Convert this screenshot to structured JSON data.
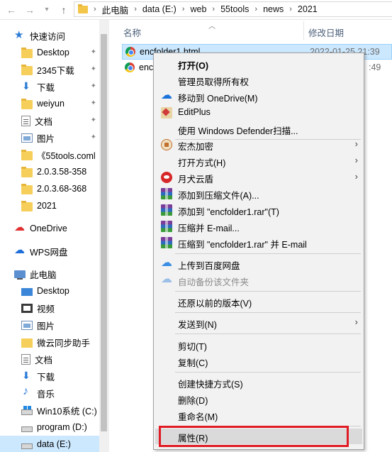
{
  "address_bar": {
    "breadcrumbs": [
      "此电脑",
      "data (E:)",
      "web",
      "55tools",
      "news",
      "2021"
    ]
  },
  "sidebar": {
    "items": [
      {
        "label": "快速访问",
        "icon": "star-icon"
      },
      {
        "label": "Desktop",
        "icon": "folder-icon",
        "pinned": true
      },
      {
        "label": "2345下载",
        "icon": "folder-icon",
        "pinned": true
      },
      {
        "label": "下载",
        "icon": "download-icon",
        "pinned": true
      },
      {
        "label": "weiyun",
        "icon": "folder-icon",
        "pinned": true
      },
      {
        "label": "文档",
        "icon": "document-icon",
        "pinned": true
      },
      {
        "label": "图片",
        "icon": "picture-icon",
        "pinned": true
      },
      {
        "label": "《55tools.coml",
        "icon": "folder-icon"
      },
      {
        "label": "2.0.3.58-358",
        "icon": "folder-icon"
      },
      {
        "label": "2.0.3.68-368",
        "icon": "folder-icon"
      },
      {
        "label": "2021",
        "icon": "folder-icon"
      },
      {
        "label": "OneDrive",
        "icon": "onedrive-icon"
      },
      {
        "label": "WPS网盘",
        "icon": "wps-cloud-icon"
      },
      {
        "label": "此电脑",
        "icon": "computer-icon"
      },
      {
        "label": "Desktop",
        "icon": "desktop-icon"
      },
      {
        "label": "视频",
        "icon": "video-icon"
      },
      {
        "label": "图片",
        "icon": "picture-icon"
      },
      {
        "label": "微云同步助手",
        "icon": "folder-icon"
      },
      {
        "label": "文档",
        "icon": "document-icon"
      },
      {
        "label": "下载",
        "icon": "download-icon"
      },
      {
        "label": "音乐",
        "icon": "music-icon"
      },
      {
        "label": "Win10系统 (C:)",
        "icon": "windows-drive-icon"
      },
      {
        "label": "program (D:)",
        "icon": "drive-icon"
      },
      {
        "label": "data (E:)",
        "icon": "drive-icon"
      }
    ]
  },
  "file_list": {
    "columns": {
      "name": "名称",
      "date": "修改日期"
    },
    "rows": [
      {
        "name": "encfolder1.html",
        "date": "2022-01-25 21:39",
        "selected": true
      },
      {
        "name": "enc",
        "date": ":49",
        "selected": false
      }
    ]
  },
  "context_menu": {
    "items": [
      {
        "label": "打开(O)",
        "bold": true
      },
      {
        "label": "管理员取得所有权"
      },
      {
        "label": "移动到 OneDrive(M)",
        "icon": "onedrive-icon"
      },
      {
        "label": "EditPlus",
        "icon": "editplus-icon"
      },
      {
        "label": "使用 Windows Defender扫描..."
      },
      {
        "label": "宏杰加密",
        "icon": "lock-icon",
        "submenu": true
      },
      {
        "label": "打开方式(H)",
        "submenu": true
      },
      {
        "label": "月犬云盾",
        "icon": "yuedun-icon",
        "submenu": true
      },
      {
        "label": "添加到压缩文件(A)...",
        "icon": "winrar-icon"
      },
      {
        "label": "添加到 \"encfolder1.rar\"(T)",
        "icon": "winrar-icon"
      },
      {
        "label": "压缩并 E-mail...",
        "icon": "winrar-icon"
      },
      {
        "label": "压缩到 \"encfolder1.rar\" 并 E-mail",
        "icon": "winrar-icon"
      },
      {
        "label": "上传到百度网盘",
        "icon": "baidu-cloud-icon"
      },
      {
        "label": "自动备份该文件夹",
        "icon": "baidu-cloud-icon",
        "disabled": true
      },
      {
        "label": "还原以前的版本(V)"
      },
      {
        "label": "发送到(N)",
        "submenu": true
      },
      {
        "label": "剪切(T)"
      },
      {
        "label": "复制(C)"
      },
      {
        "label": "创建快捷方式(S)"
      },
      {
        "label": "删除(D)"
      },
      {
        "label": "重命名(M)"
      },
      {
        "label": "属性(R)",
        "highlighted": true
      }
    ]
  },
  "colors": {
    "selection": "#cce8ff",
    "highlight_border": "#e01b24",
    "menu_bg": "#f2f2f2"
  }
}
